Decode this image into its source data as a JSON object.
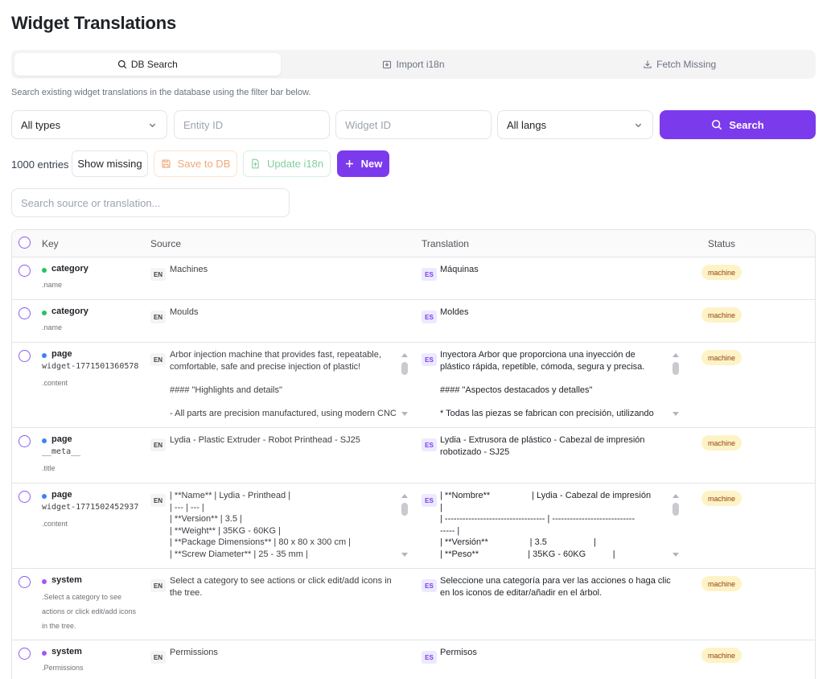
{
  "page": {
    "title": "Widget Translations"
  },
  "tabs": [
    {
      "label": "DB Search",
      "icon": "search-icon",
      "active": true
    },
    {
      "label": "Import i18n",
      "icon": "import-icon",
      "active": false
    },
    {
      "label": "Fetch Missing",
      "icon": "download-icon",
      "active": false
    }
  ],
  "hint": "Search existing widget translations in the database using the filter bar below.",
  "filters": {
    "type_value": "All types",
    "entity_placeholder": "Entity ID",
    "widget_placeholder": "Widget ID",
    "lang_value": "All langs",
    "search_label": "Search"
  },
  "toolbar": {
    "entries": "1000 entries",
    "show_missing": "Show missing",
    "save_to_db": "Save to DB",
    "update_i18n": "Update i18n",
    "new": "New"
  },
  "text_search": {
    "placeholder": "Search source or translation..."
  },
  "colors": {
    "accent": "#7c3aed",
    "badge_bg": "#fef3c7",
    "badge_fg": "#92400e"
  },
  "table": {
    "headers": {
      "key": "Key",
      "source": "Source",
      "translation": "Translation",
      "status": "Status"
    },
    "rows": [
      {
        "key": "category",
        "key_mono": "",
        "sub": ".name",
        "dot": "green",
        "src_lang": "EN",
        "source": "Machines",
        "tr_lang": "ES",
        "translation": "Máquinas",
        "status": "machine"
      },
      {
        "key": "category",
        "key_mono": "",
        "sub": ".name",
        "dot": "green",
        "src_lang": "EN",
        "source": "Moulds",
        "tr_lang": "ES",
        "translation": "Moldes",
        "status": "machine"
      },
      {
        "key": "page",
        "key_mono": "widget-1771501360578",
        "sub": ".content",
        "dot": "blue",
        "src_lang": "EN",
        "source": "Arbor injection machine that provides fast, repeatable,\ncomfortable, safe and precise injection of plastic!\n\n#### \"Highlights and details\"\n\n- All parts are precision manufactured, using modern CNC",
        "tr_lang": "ES",
        "translation": "Inyectora Arbor que proporciona una inyección de\nplástico rápida, repetible, cómoda, segura y precisa.\n\n#### \"Aspectos destacados y detalles\"\n\n* Todas las piezas se fabrican con precisión, utilizando",
        "status": "machine"
      },
      {
        "key": "page",
        "key_mono": "__meta__",
        "sub": ".title",
        "dot": "blue",
        "src_lang": "EN",
        "source": "Lydia - Plastic Extruder - Robot Printhead - SJ25",
        "tr_lang": "ES",
        "translation": "Lydia - Extrusora de plástico - Cabezal de impresión robotizado - SJ25",
        "status": "machine"
      },
      {
        "key": "page",
        "key_mono": "widget-1771502452937",
        "sub": ".content",
        "dot": "blue",
        "src_lang": "EN",
        "source": "| **Name** | Lydia - Printhead |\n| --- | --- |\n| **Version** | 3.5 |\n| **Weight** | 35KG - 60KG |\n| **Package Dimensions** | 80 x 80 x 300 cm |\n| **Screw Diameter** | 25 - 35 mm |",
        "tr_lang": "ES",
        "translation": "| **Nombre**                 | Lydia - Cabezal de impresión\n|\n| ---------------------------------- | ----------------------------\n----- |\n| **Versión**                 | 3.5                   |\n| **Peso**                    | 35KG - 60KG           |",
        "status": "machine"
      },
      {
        "key": "system",
        "key_mono": "",
        "sub": ".Select a category to see actions or click edit/add icons in the tree.",
        "dot": "purple",
        "src_lang": "EN",
        "source": "Select a category to see actions or click edit/add icons in the tree.",
        "tr_lang": "ES",
        "translation": "Seleccione una categoría para ver las acciones o haga clic en los iconos de editar/añadir en el árbol.",
        "status": "machine"
      },
      {
        "key": "system",
        "key_mono": "",
        "sub": ".Permissions",
        "dot": "purple",
        "src_lang": "EN",
        "source": "Permissions",
        "tr_lang": "ES",
        "translation": "Permisos",
        "status": "machine"
      }
    ]
  }
}
